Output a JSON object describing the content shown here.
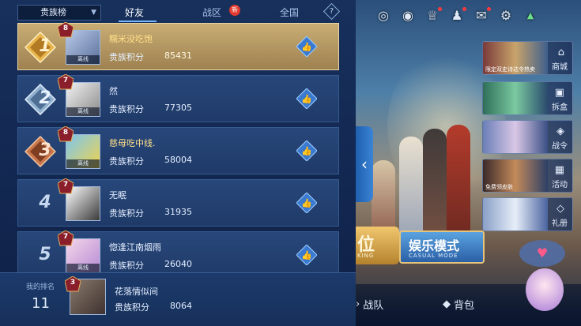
{
  "tabs": {
    "board_select": "贵族榜",
    "friends": "好友",
    "region": "战区",
    "new_badge": "新",
    "national": "全国",
    "help": "?"
  },
  "rows": [
    {
      "rank": "1",
      "level": "8",
      "name": "糯米没吃饱",
      "status": "离线",
      "score_label": "贵族积分",
      "score": "85431"
    },
    {
      "rank": "2",
      "level": "7",
      "name": "然",
      "status": "离线",
      "score_label": "贵族积分",
      "score": "77305"
    },
    {
      "rank": "3",
      "level": "8",
      "name": "慈母吃中线.",
      "status": "离线",
      "score_label": "贵族积分",
      "score": "58004"
    },
    {
      "rank": "4",
      "level": "7",
      "name": "无眠",
      "status": "",
      "score_label": "贵族积分",
      "score": "31935"
    },
    {
      "rank": "5",
      "level": "7",
      "name": "惚逢江南烟雨",
      "status": "离线",
      "score_label": "贵族积分",
      "score": "26040"
    }
  ],
  "my_rank": {
    "label": "我的排名",
    "rank": "11",
    "level": "3",
    "name": "花落情似间",
    "score_label": "贵族积分",
    "score": "8064"
  },
  "side_menu": [
    {
      "caption": "限定双史诗达令热卖",
      "label": "商城"
    },
    {
      "caption": "",
      "label": "拆盒"
    },
    {
      "caption": "",
      "label": "战令"
    },
    {
      "caption": "免费领皮肤",
      "label": "活动"
    },
    {
      "caption": "",
      "label": "礼册"
    }
  ],
  "modes": {
    "rank_title": "位",
    "rank_sub": "KING",
    "casual_title": "娱乐模式",
    "casual_sub": "CASUAL MODE"
  },
  "bottom": {
    "team": "战队",
    "bag": "背包"
  },
  "colors": {
    "panel_bg": "#17305c",
    "first_row_gold": "#c9ad74",
    "accent_blue": "#78b6ff",
    "new_red": "#e23a2e"
  }
}
